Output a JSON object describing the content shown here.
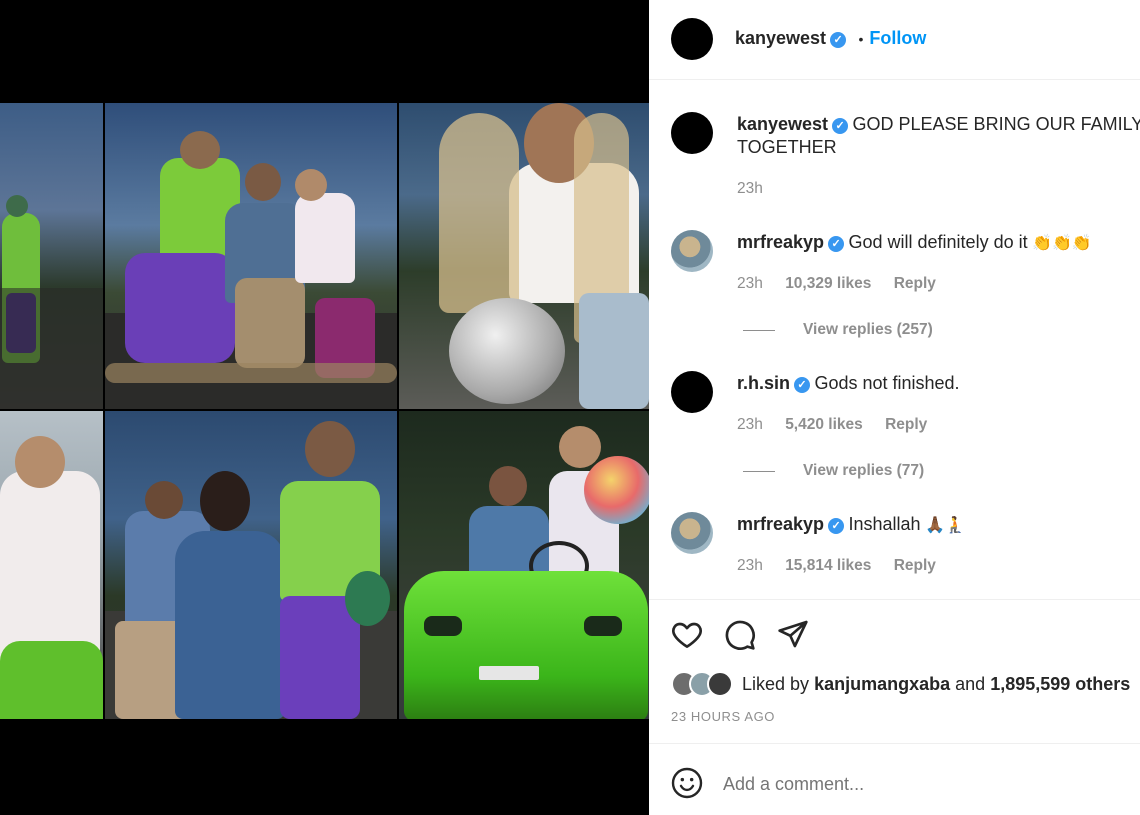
{
  "post": {
    "author": "kanyewest",
    "follow_label": "Follow",
    "dot": "•",
    "verified_glyph": "✓"
  },
  "caption": {
    "username": "kanyewest",
    "text": "GOD PLEASE BRING OUR FAMILY",
    "text_line2": "TOGETHER",
    "time": "23h"
  },
  "comments": [
    {
      "username": "mrfreakyp",
      "text": "God will definitely do it",
      "emoji": "👏👏👏",
      "time": "23h",
      "likes": "10,329 likes",
      "reply": "Reply",
      "view_replies": "View replies (257)"
    },
    {
      "username": "r.h.sin",
      "text": "Gods not finished.",
      "time": "23h",
      "likes": "5,420 likes",
      "reply": "Reply",
      "view_replies": "View replies (77)"
    },
    {
      "username": "mrfreakyp",
      "text": "Inshallah",
      "emoji": "🙏🏾🧎",
      "time": "23h",
      "likes": "15,814 likes",
      "reply": "Reply"
    }
  ],
  "actions": {
    "like_icon": "heart-icon",
    "comment_icon": "comment-icon",
    "share_icon": "paper-plane-icon"
  },
  "likes": {
    "prefix": "Liked by",
    "user": "kanjumangxaba",
    "and": "and",
    "count": "1,895,599 others"
  },
  "timestamp": "23 HOURS AGO",
  "comment_box": {
    "placeholder": "Add a comment...",
    "emoji_icon": "smiley-icon"
  },
  "colors": {
    "accent": "#0095f6",
    "verified": "#3897f0",
    "secondary_text": "#8e8e8e"
  }
}
